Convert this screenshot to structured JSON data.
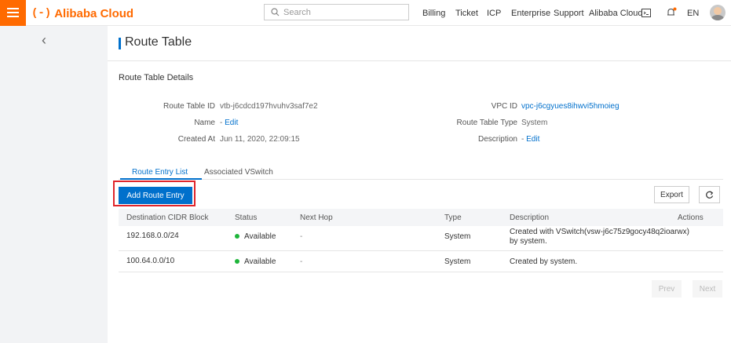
{
  "header": {
    "logo_mark": "(-)",
    "logo_text": "Alibaba Cloud",
    "search_placeholder": "Search",
    "nav": [
      "Billing",
      "Ticket",
      "ICP",
      "Enterprise",
      "Support",
      "Alibaba Cloud",
      "EN"
    ]
  },
  "sidebar": {
    "back_icon": "chevron-left-icon"
  },
  "page": {
    "title": "Route Table",
    "section_title": "Route Table Details",
    "details": {
      "route_table_id_label": "Route Table ID",
      "route_table_id": "vtb-j6cdcd197hvuhv3saf7e2",
      "name_label": "Name",
      "name_value": "-",
      "name_edit": "Edit",
      "created_at_label": "Created At",
      "created_at": "Jun 11, 2020, 22:09:15",
      "vpc_id_label": "VPC ID",
      "vpc_id": "vpc-j6cgyues8ihwvi5hmoieg",
      "type_label": "Route Table Type",
      "type_value": "System",
      "description_label": "Description",
      "description_value": "-",
      "description_edit": "Edit"
    },
    "tabs": [
      "Route Entry List",
      "Associated VSwitch"
    ],
    "add_button": "Add Route Entry",
    "export_button": "Export",
    "table": {
      "columns": [
        "Destination CIDR Block",
        "Status",
        "Next Hop",
        "Type",
        "Description",
        "Actions"
      ],
      "rows": [
        {
          "cidr": "192.168.0.0/24",
          "status": "Available",
          "next_hop": "-",
          "type": "System",
          "description_line1": "Created with VSwitch(vsw-j6c75z9gocy48q2ioarwx)",
          "description_line2": "by system."
        },
        {
          "cidr": "100.64.0.0/10",
          "status": "Available",
          "next_hop": "-",
          "type": "System",
          "description_line1": "Created by system.",
          "description_line2": ""
        }
      ]
    },
    "pagination": {
      "prev": "Prev",
      "next": "Next"
    }
  },
  "colors": {
    "accent": "#0070cc",
    "brand": "#ff6a00",
    "status_available": "#1eb53a",
    "highlight": "#e0252b"
  }
}
